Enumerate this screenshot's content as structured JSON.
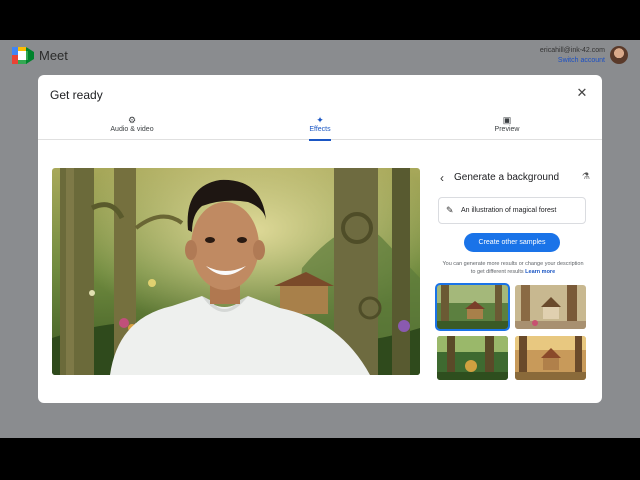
{
  "app": {
    "name": "Meet"
  },
  "account": {
    "email": "ericahill@ink-42.com",
    "switch_label": "Switch account"
  },
  "dialog": {
    "title": "Get ready",
    "close_icon": "close-icon"
  },
  "tabs": [
    {
      "label": "Audio & video",
      "icon": "audio-video-settings-icon",
      "active": false
    },
    {
      "label": "Effects",
      "icon": "sparkle-icon",
      "active": true
    },
    {
      "label": "Preview",
      "icon": "preview-icon",
      "active": false
    }
  ],
  "panel": {
    "title": "Generate a background",
    "back_icon": "chevron-left-icon",
    "lab_icon": "flask-icon",
    "prompt": "An illustration of magical forest",
    "prompt_icon": "magic-pen-icon",
    "create_button": "Create other samples",
    "hint": "You can generate more results or change your description to get different results",
    "learn_more": "Learn more"
  },
  "colors": {
    "accent": "#1a73e8",
    "active_tab": "#1a56c4"
  }
}
